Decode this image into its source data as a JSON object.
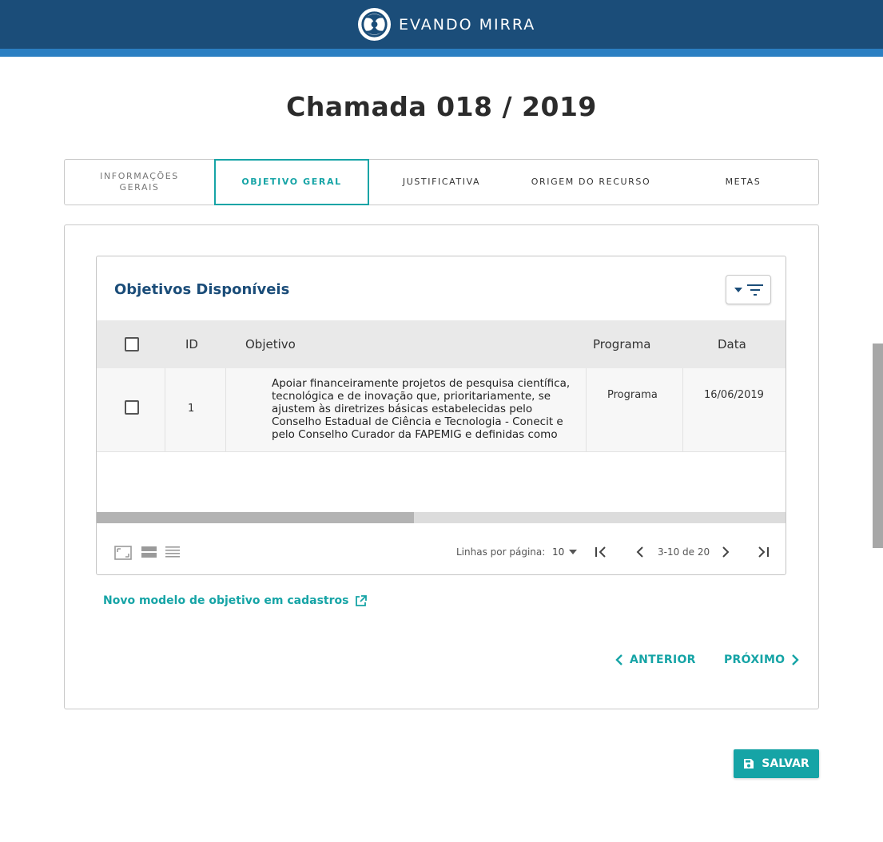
{
  "header": {
    "brand_name": "EVANDO MIRRA"
  },
  "page": {
    "title": "Chamada 018 / 2019"
  },
  "tabs": [
    {
      "label": "INFORMAÇÕES GERAIS",
      "active": false
    },
    {
      "label": "OBJETIVO GERAL",
      "active": true
    },
    {
      "label": "JUSTIFICATIVA",
      "active": false
    },
    {
      "label": "ORIGEM DO RECURSO",
      "active": false
    },
    {
      "label": "METAS",
      "active": false
    }
  ],
  "table": {
    "title": "Objetivos Disponíveis",
    "columns": {
      "id": "ID",
      "objective": "Objetivo",
      "program": "Programa",
      "date": "Data"
    },
    "rows": [
      {
        "id": "1",
        "objective": "Apoiar financeiramente projetos de pesquisa científica, tecnológica e de inovação que, prioritariamente, se ajustem às diretrizes básicas estabelecidas pelo Conselho Estadual de Ciência e Tecnologia - Conecit e pelo Conselho Curador da FAPEMIG e definidas como",
        "program": "Programa",
        "date": "16/06/2019",
        "checked": false
      }
    ],
    "pagination": {
      "rows_per_page_label": "Linhas por página:",
      "rows_per_page": "10",
      "range": "3-10 de 20"
    },
    "horizontal_scroll_fraction": 0.46
  },
  "links": {
    "new_model": "Novo modelo de objetivo em cadastros"
  },
  "navigation": {
    "previous": "ANTERIOR",
    "next": "PRÓXIMO"
  },
  "actions": {
    "save": "SALVAR"
  },
  "colors": {
    "header": "#1b4d79",
    "stripe": "#2b7fc2",
    "accent": "#16a4a6"
  },
  "icons": [
    "brand-logo-icon",
    "filter-icon",
    "sort-down-icon",
    "checkbox-icon",
    "density-comfortable-icon",
    "density-standard-icon",
    "density-compact-icon",
    "first-page-icon",
    "prev-page-icon",
    "next-page-icon",
    "last-page-icon",
    "external-link-icon",
    "chevron-left-icon",
    "chevron-right-icon",
    "save-icon"
  ]
}
